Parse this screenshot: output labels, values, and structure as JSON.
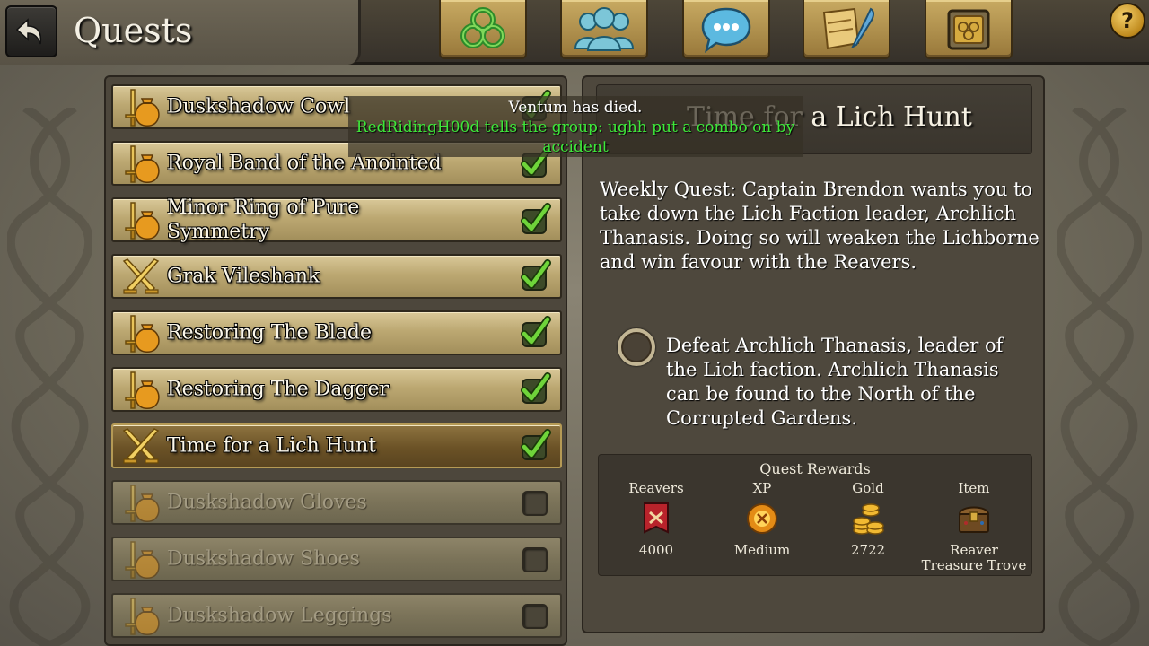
{
  "header": {
    "title": "Quests",
    "back_icon": "back-arrow-icon",
    "nav_buttons": [
      {
        "name": "trinity-knot-icon"
      },
      {
        "name": "guild-members-icon"
      },
      {
        "name": "chat-bubble-icon"
      },
      {
        "name": "map-scroll-quill-icon"
      },
      {
        "name": "inventory-chest-icon"
      }
    ],
    "help_label": "?"
  },
  "quests": [
    {
      "name": "Duskshadow Cowl",
      "icon": "sword-pouch-icon",
      "completed": true,
      "selected": false,
      "active": true
    },
    {
      "name": "Royal Band of the Anointed",
      "icon": "sword-pouch-icon",
      "completed": true,
      "selected": false,
      "active": true
    },
    {
      "name": "Minor Ring of Pure Symmetry",
      "icon": "sword-pouch-icon",
      "completed": true,
      "selected": false,
      "active": true
    },
    {
      "name": "Grak Vileshank",
      "icon": "crossed-swords-icon",
      "completed": true,
      "selected": false,
      "active": true
    },
    {
      "name": "Restoring The Blade",
      "icon": "sword-pouch-icon",
      "completed": true,
      "selected": false,
      "active": true
    },
    {
      "name": "Restoring The Dagger",
      "icon": "sword-pouch-icon",
      "completed": true,
      "selected": false,
      "active": true
    },
    {
      "name": "Time for a Lich Hunt",
      "icon": "crossed-swords-icon",
      "completed": true,
      "selected": true,
      "active": true
    },
    {
      "name": "Duskshadow Gloves",
      "icon": "sword-pouch-icon",
      "completed": false,
      "selected": false,
      "active": false
    },
    {
      "name": "Duskshadow Shoes",
      "icon": "sword-pouch-icon",
      "completed": false,
      "selected": false,
      "active": false
    },
    {
      "name": "Duskshadow Leggings",
      "icon": "sword-pouch-icon",
      "completed": false,
      "selected": false,
      "active": false
    }
  ],
  "chat": {
    "line1": "Ventum has died.",
    "line2": "RedRidingH00d tells the group: ughh put a combo on by accident",
    "line2_color": "#3ee83a"
  },
  "detail": {
    "title": "Time for a Lich Hunt",
    "description": "Weekly Quest: Captain Brendon wants you to take down the Lich Faction leader, Archlich Thanasis. Doing so will weaken the Lichborne and win favour with the Reavers.",
    "objective": "Defeat Archlich Thanasis, leader of the Lich faction. Archlich Thanasis can be found to the North of the Corrupted Gardens.",
    "objective_icon": "objective-ring-icon"
  },
  "rewards": {
    "title": "Quest Rewards",
    "items": [
      {
        "label": "Reavers",
        "value": "4000",
        "icon": "reavers-banner-icon"
      },
      {
        "label": "XP",
        "value": "Medium",
        "icon": "xp-orb-icon"
      },
      {
        "label": "Gold",
        "value": "2722",
        "icon": "gold-coins-icon"
      },
      {
        "label": "Item",
        "value": "Reaver Treasure Trove",
        "icon": "treasure-chest-icon"
      }
    ]
  },
  "colors": {
    "row_gold": "#bca872",
    "row_selected": "#6b5226",
    "row_inactive": "#7b7359",
    "check_green": "#5ec52a",
    "chat_green": "#3ee83a"
  }
}
